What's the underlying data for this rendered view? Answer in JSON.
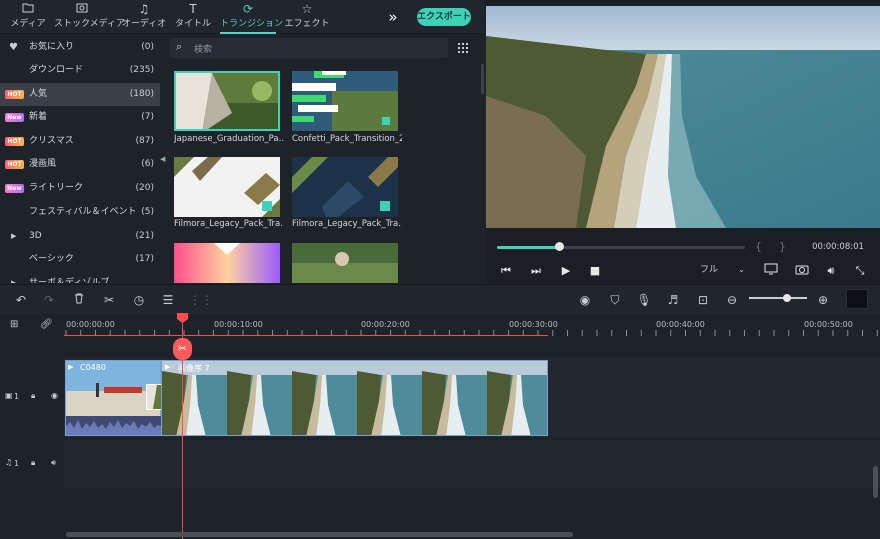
{
  "nav": {
    "tabs": [
      {
        "label": "メディア",
        "icon": "folder-icon"
      },
      {
        "label": "ストックメディア",
        "icon": "image-folder-icon"
      },
      {
        "label": "オーディオ",
        "icon": "music-note-icon"
      },
      {
        "label": "タイトル",
        "icon": "title-t-icon"
      },
      {
        "label": "トランジション",
        "icon": "transition-icon"
      },
      {
        "label": "エフェクト",
        "icon": "effects-icon"
      }
    ],
    "active_tab": "トランジション",
    "export_label": "エクスポート",
    "more_icon": "double-chevron-right-icon"
  },
  "sidebar": {
    "items": [
      {
        "name": "お気に入り",
        "count": "(0)",
        "badge": "",
        "icon": "heart-icon"
      },
      {
        "name": "ダウンロード",
        "count": "(235)",
        "badge": ""
      },
      {
        "name": "人気",
        "count": "(180)",
        "badge": "HOT",
        "selected": true
      },
      {
        "name": "新着",
        "count": "(7)",
        "badge": "New"
      },
      {
        "name": "クリスマス",
        "count": "(87)",
        "badge": "HOT"
      },
      {
        "name": "漫画風",
        "count": "(6)",
        "badge": "HOT"
      },
      {
        "name": "ライトリーク",
        "count": "(20)",
        "badge": "New"
      },
      {
        "name": "フェスティバル＆イベント",
        "count": "(5)",
        "badge": ""
      },
      {
        "name": "3D",
        "count": "(21)",
        "badge": "",
        "expandable": true
      },
      {
        "name": "ベーシック",
        "count": "(17)",
        "badge": ""
      },
      {
        "name": "サーボ＆ディゾルブ",
        "count": "",
        "badge": "",
        "expandable": true
      }
    ]
  },
  "library": {
    "search_placeholder": "検索",
    "items": [
      {
        "label": "Japanese_Graduation_Pa...",
        "selected": true
      },
      {
        "label": "Confetti_Pack_Transition_2"
      },
      {
        "label": "Filmora_Legacy_Pack_Tra..."
      },
      {
        "label": "Filmora_Legacy_Pack_Tra..."
      },
      {
        "label": ""
      },
      {
        "label": ""
      }
    ]
  },
  "player": {
    "timecode": "00:00:08:01",
    "progress": 0.25,
    "bracket_in": "{",
    "bracket_out": "}",
    "quality": "フル"
  },
  "timeline": {
    "ruler_labels": [
      "00:00:00:00",
      "00:00:10:00",
      "00:00:20:00",
      "00:00:30:00",
      "00:00:40:00",
      "00:00:50:00"
    ],
    "clips": [
      {
        "label": "C0480"
      },
      {
        "label": "画像序 7"
      }
    ],
    "video_track_label": "1",
    "audio_track_label": "1"
  },
  "colors": {
    "accent": "#3fd1b5",
    "playhead": "#ff4d4d",
    "clip_border": "#7aa0d8"
  }
}
